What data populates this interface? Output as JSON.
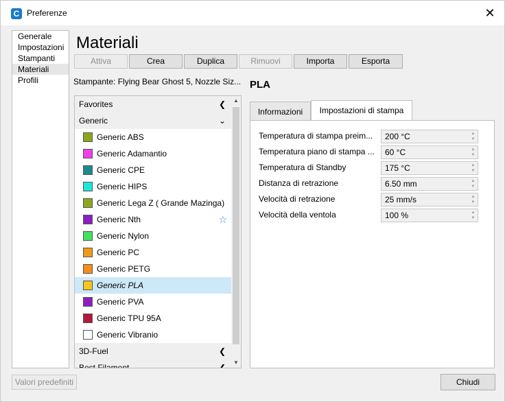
{
  "window": {
    "title": "Preferenze"
  },
  "nav": {
    "items": [
      {
        "label": "Generale"
      },
      {
        "label": "Impostazioni"
      },
      {
        "label": "Stampanti"
      },
      {
        "label": "Materiali"
      },
      {
        "label": "Profili"
      }
    ],
    "active_index": 3
  },
  "page_title": "Materiali",
  "toolbar": {
    "activate_label": "Attiva",
    "create_label": "Crea",
    "duplicate_label": "Duplica",
    "remove_label": "Rimuovi",
    "import_label": "Importa",
    "export_label": "Esporta"
  },
  "printer_label": "Stampante: Flying Bear Ghost 5, Nozzle Siz...",
  "material_list": {
    "groups": [
      {
        "name": "Favorites",
        "expanded": false
      },
      {
        "name": "Generic",
        "expanded": true
      },
      {
        "name": "3D-Fuel",
        "expanded": false
      },
      {
        "name": "Best Filament",
        "expanded": false
      }
    ],
    "items": [
      {
        "name": "Generic ABS",
        "color": "#8ca71f"
      },
      {
        "name": "Generic Adamantio",
        "color": "#ef3fe8"
      },
      {
        "name": "Generic CPE",
        "color": "#1b8a8c"
      },
      {
        "name": "Generic HIPS",
        "color": "#1ee6dc"
      },
      {
        "name": "Generic Lega Z ( Grande Mazinga)",
        "color": "#8ca71f"
      },
      {
        "name": "Generic Nth",
        "color": "#8a1fbf"
      },
      {
        "name": "Generic Nylon",
        "color": "#3fe35c"
      },
      {
        "name": "Generic PC",
        "color": "#f09a17"
      },
      {
        "name": "Generic PETG",
        "color": "#f58d1a"
      },
      {
        "name": "Generic PLA",
        "color": "#f6c51f"
      },
      {
        "name": "Generic PVA",
        "color": "#8a1fbf"
      },
      {
        "name": "Generic TPU 95A",
        "color": "#b0183c"
      },
      {
        "name": "Generic Vibranio",
        "color": "#ffffff"
      }
    ],
    "selected": "Generic PLA",
    "star_item": "Generic Nth"
  },
  "material_detail": {
    "name": "PLA",
    "tabs": [
      {
        "label": "Informazioni"
      },
      {
        "label": "Impostazioni di stampa"
      }
    ],
    "active_tab": 1,
    "settings": [
      {
        "label": "Temperatura di stampa preim...",
        "value": "200 °C"
      },
      {
        "label": "Temperatura piano di stampa ...",
        "value": "60 °C"
      },
      {
        "label": "Temperatura di Standby",
        "value": "175 °C"
      },
      {
        "label": "Distanza di retrazione",
        "value": "6.50 mm"
      },
      {
        "label": "Velocità di retrazione",
        "value": "25 mm/s"
      },
      {
        "label": "Velocità della ventola",
        "value": "100 %"
      }
    ]
  },
  "footer": {
    "defaults_label": "Valori predefiniti",
    "close_label": "Chiudi"
  },
  "icons": {
    "app": "cura-logo-icon",
    "close": "close-icon",
    "collapse": "chevron-left-icon",
    "expand": "chevron-down-icon",
    "favorite": "star-outline-icon"
  }
}
